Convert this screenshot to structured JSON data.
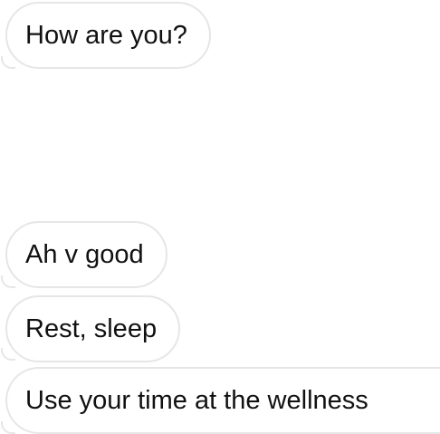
{
  "messages": [
    {
      "text": "How are you?"
    },
    {
      "text": "Ah v good"
    },
    {
      "text": "Rest, sleep"
    },
    {
      "text": "Use your time at the wellness"
    }
  ]
}
